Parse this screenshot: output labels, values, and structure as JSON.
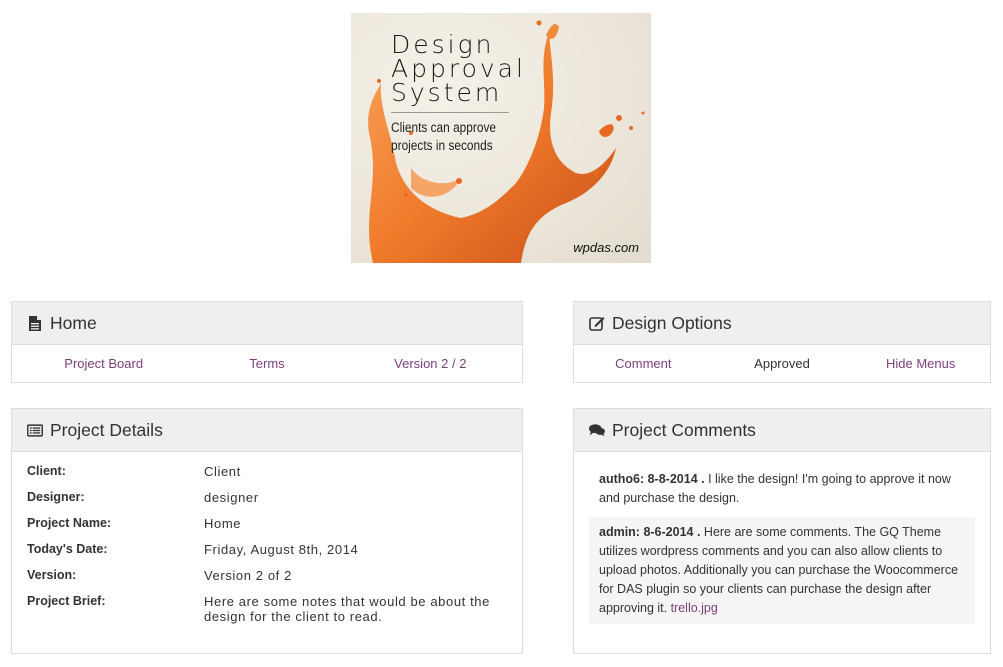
{
  "banner": {
    "title_lines": [
      "Design",
      "Approval",
      "System"
    ],
    "tagline": "Clients can approve projects in seconds",
    "url": "wpdas.com"
  },
  "home_panel": {
    "title": "Home",
    "icon": "file-icon",
    "links": [
      "Project Board",
      "Terms",
      "Version 2 / 2"
    ]
  },
  "design_options": {
    "title": "Design Options",
    "icon": "edit-icon",
    "comment": "Comment",
    "status": "Approved",
    "hide_menus": "Hide Menus"
  },
  "project_details": {
    "title": "Project Details",
    "icon": "list-alt-icon",
    "rows": [
      {
        "label": "Client:",
        "value": "Client"
      },
      {
        "label": "Designer:",
        "value": "designer"
      },
      {
        "label": "Project Name:",
        "value": "Home"
      },
      {
        "label": "Today's Date:",
        "value": "Friday, August 8th, 2014"
      },
      {
        "label": "Version:",
        "value": "Version 2 of 2"
      },
      {
        "label": "Project Brief:",
        "value": "Here are some notes that would be about the design for the client to read."
      }
    ]
  },
  "project_comments": {
    "title": "Project Comments",
    "icon": "comments-icon",
    "items": [
      {
        "meta": "autho6: 8-8-2014 .",
        "text": " I like the design! I'm going to approve it now and purchase the design."
      },
      {
        "meta": "admin: 8-6-2014 .",
        "text": " Here are some comments. The GQ Theme utilizes wordpress comments and you can also allow clients to upload photos. Additionally you can purchase the Woocommerce for DAS plugin so your clients can purchase the design after approving it. ",
        "attachment": "trello.jpg"
      }
    ]
  },
  "colors": {
    "link": "#7b3f7d",
    "panel_header": "#efefef",
    "splash": "#f07a2a"
  }
}
